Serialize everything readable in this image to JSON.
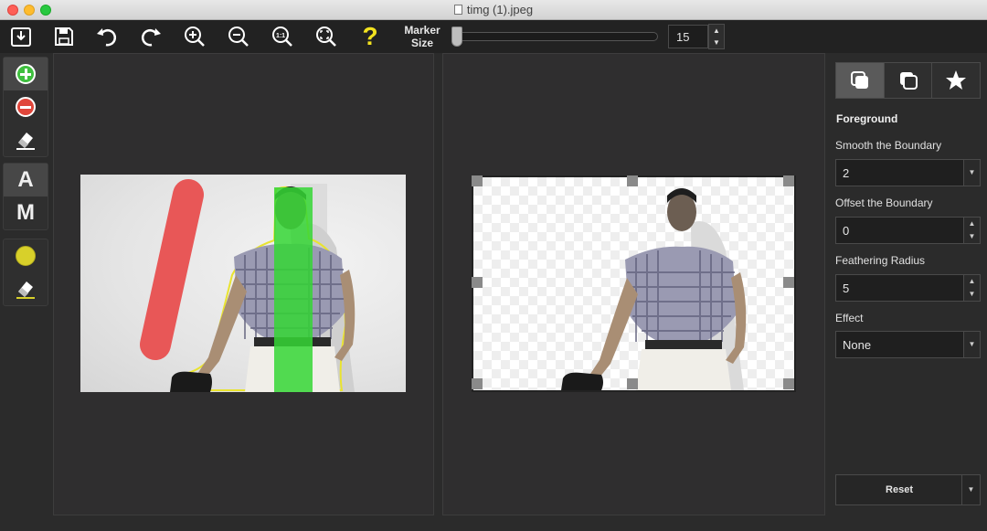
{
  "window": {
    "title": "timg (1).jpeg"
  },
  "toolbar": {
    "help_label": "?",
    "marker_label_line1": "Marker",
    "marker_label_line2": "Size",
    "marker_value": "15",
    "marker_fraction": 0.0
  },
  "left_tools": {
    "text_mode_a": "A",
    "text_mode_m": "M",
    "marker_color": "#d8d02a"
  },
  "right_panel": {
    "section_title": "Foreground",
    "smooth_label": "Smooth the Boundary",
    "smooth_value": "2",
    "offset_label": "Offset the Boundary",
    "offset_value": "0",
    "feather_label": "Feathering Radius",
    "feather_value": "5",
    "effect_label": "Effect",
    "effect_value": "None",
    "reset_label": "Reset"
  },
  "icons": {
    "stepper_up": "▲",
    "stepper_down": "▼",
    "dropdown": "▼"
  }
}
